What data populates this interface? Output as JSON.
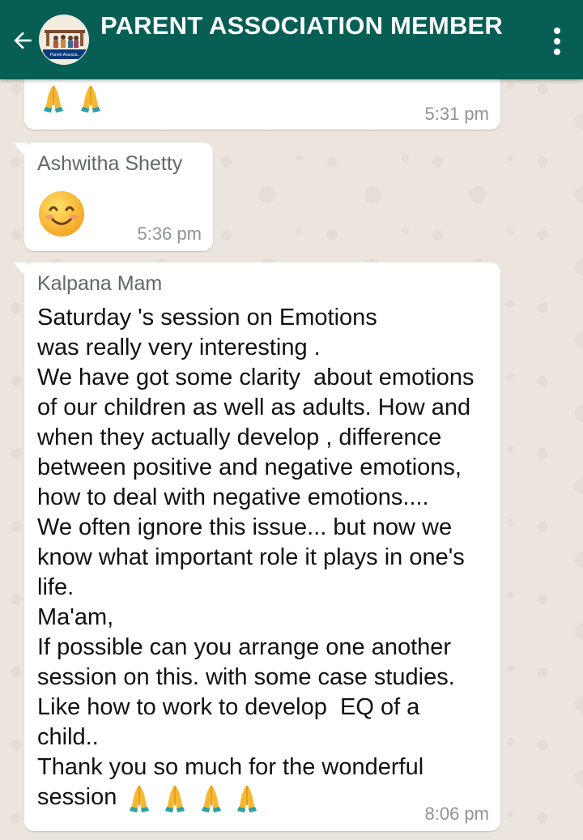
{
  "header": {
    "title": "PARENT ASSOCIATION MEMBER",
    "avatar_caption": "Parent Associa..",
    "back_icon": "arrow-left-icon",
    "menu_icon": "more-vertical-icon",
    "background_color": "#075e54"
  },
  "messages": [
    {
      "sender": "",
      "text": "",
      "emojis": [
        "folded-hands",
        "folded-hands"
      ],
      "time": "5:31 pm"
    },
    {
      "sender": "Ashwitha Shetty",
      "text": "",
      "emojis": [
        "smiling-face"
      ],
      "time": "5:36 pm"
    },
    {
      "sender": "Kalpana Mam",
      "text": "Saturday 's session on Emotions\nwas really very interesting .\nWe have got some clarity  about emotions\nof our children as well as adults. How and\nwhen they actually develop , difference\nbetween positive and negative emotions,\nhow to deal with negative emotions....\nWe often ignore this issue... but now we\nknow what important role it plays in one's\nlife.\nMa'am,\nIf possible can you arrange one another\nsession on this. with some case studies.\nLike how to work to develop  EQ of a\nchild..\nThank you so much for the wonderful\nsession",
      "emojis": [
        "folded-hands",
        "folded-hands",
        "folded-hands",
        "folded-hands"
      ],
      "time": "8:06 pm"
    }
  ]
}
